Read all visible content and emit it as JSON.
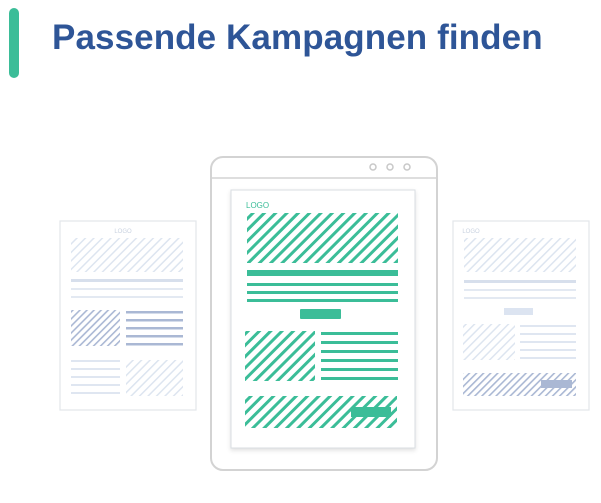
{
  "page": {
    "title": "Passende Kampagnen finden"
  },
  "illustration": {
    "left_template": {
      "logo": "LOGO"
    },
    "center_template": {
      "logo": "LOGO"
    },
    "right_template": {
      "logo": "LOGO"
    }
  },
  "colors": {
    "accent": "#3bbd98",
    "title": "#2e5597",
    "frame": "#d3d3d3",
    "muted_line": "#dfe6f1",
    "muted_hatch": "#aab8d4",
    "light_hatch": "#dde5f0"
  }
}
